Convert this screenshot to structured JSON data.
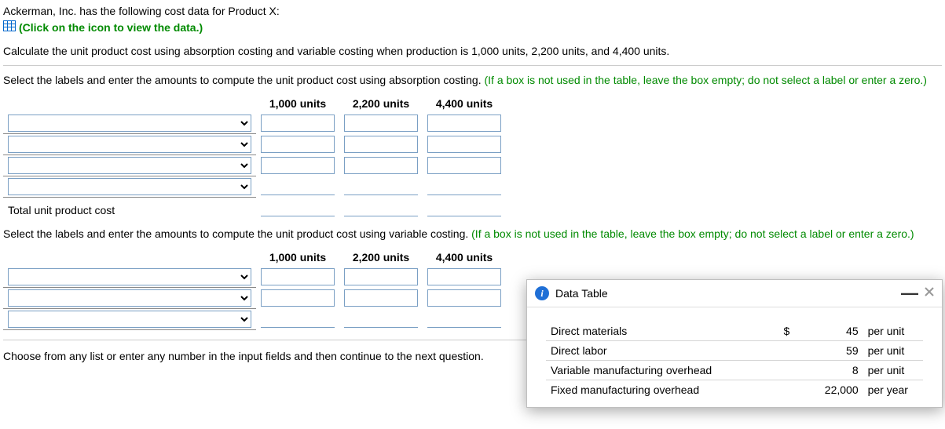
{
  "intro": {
    "line1": "Ackerman, Inc. has the following cost data for Product X:",
    "icon_link_text": "(Click on the icon to view the data.)",
    "calc_line": "Calculate the unit product cost using absorption costing and variable costing when production is 1,000 units, 2,200 units, and 4,400 units."
  },
  "absorption": {
    "instruction_text": "Select the labels and enter the amounts to compute the unit product cost using absorption costing. ",
    "hint": "(If a box is not used in the table, leave the box empty; do not select a label or enter a zero.)",
    "headers": {
      "c1": "1,000 units",
      "c2": "2,200 units",
      "c3": "4,400 units"
    },
    "total_label": "Total unit product cost"
  },
  "variable": {
    "instruction_text": "Select the labels and enter the amounts to compute the unit product cost using variable costing. ",
    "hint": "(If a box is not used in the table, leave the box empty; do not select a label or enter a zero.)",
    "headers": {
      "c1": "1,000 units",
      "c2": "2,200 units",
      "c3": "4,400 units"
    }
  },
  "footer": "Choose from any list or enter any number in the input fields and then continue to the next question.",
  "modal": {
    "title": "Data Table",
    "rows": [
      {
        "label": "Direct materials",
        "currency": "$",
        "value": "45",
        "unit": "per unit"
      },
      {
        "label": "Direct labor",
        "currency": "",
        "value": "59",
        "unit": "per unit"
      },
      {
        "label": "Variable manufacturing overhead",
        "currency": "",
        "value": "8",
        "unit": "per unit"
      },
      {
        "label": "Fixed manufacturing overhead",
        "currency": "",
        "value": "22,000",
        "unit": "per year"
      }
    ]
  }
}
